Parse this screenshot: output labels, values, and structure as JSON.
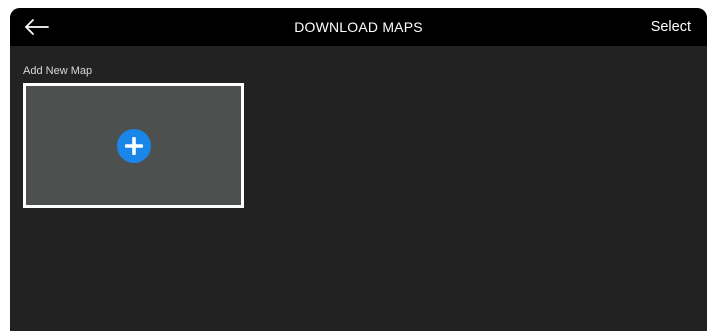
{
  "header": {
    "back_icon": "arrow-left-icon",
    "title": "DOWNLOAD MAPS",
    "select_label": "Select"
  },
  "main": {
    "section_label": "Add New Map",
    "add_tile_icon": "plus-circle-icon"
  },
  "colors": {
    "header_bg": "#000000",
    "page_bg": "#222222",
    "tile_bg": "#4c5150",
    "tile_border": "#ffffff",
    "accent": "#1a86ea"
  }
}
